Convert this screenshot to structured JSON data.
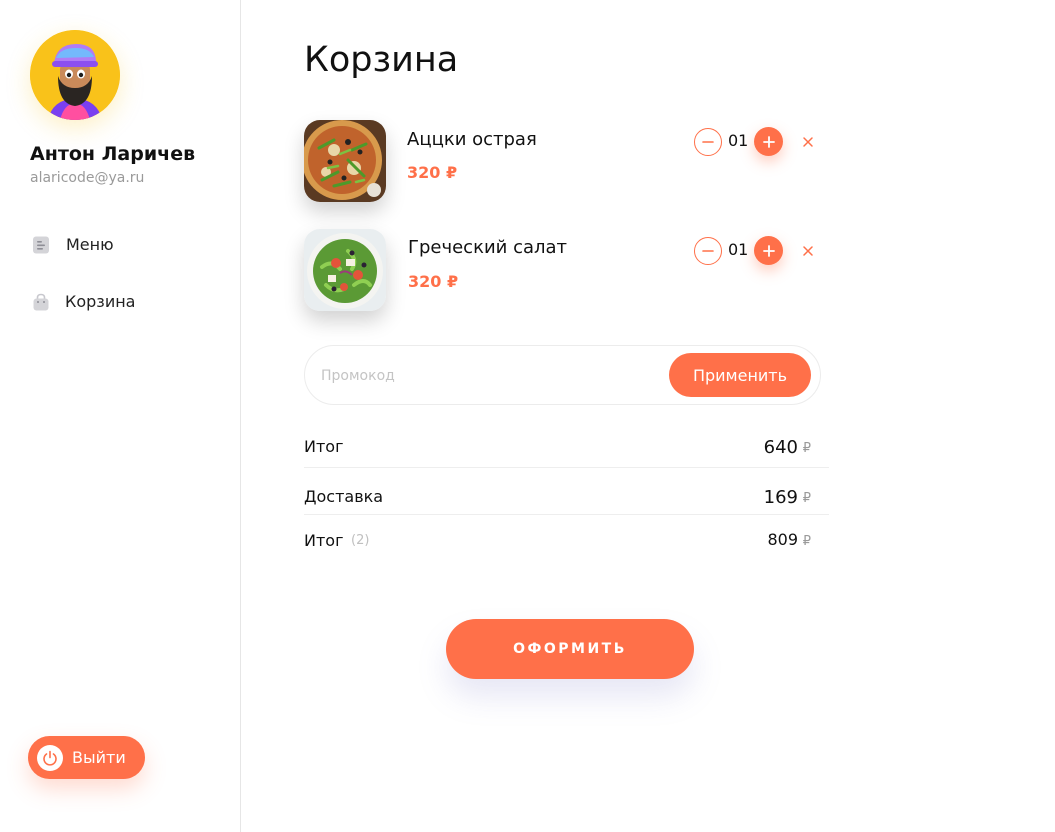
{
  "user": {
    "name": "Антон Ларичев",
    "email": "alaricode@ya.ru"
  },
  "nav": {
    "items": [
      {
        "label": "Меню",
        "icon": "menu-doc-icon"
      },
      {
        "label": "Корзина",
        "icon": "shopping-bag-icon"
      }
    ]
  },
  "logout": {
    "label": "Выйти",
    "icon": "power-icon"
  },
  "page": {
    "title": "Корзина"
  },
  "cart": {
    "items": [
      {
        "name": "Аццки острая",
        "price": "320 ₽",
        "quantity": "01",
        "image": "pizza-photo"
      },
      {
        "name": "Греческий салат",
        "price": "320 ₽",
        "quantity": "01",
        "image": "salad-photo"
      }
    ]
  },
  "promo": {
    "placeholder": "Промокод",
    "value": "",
    "apply_label": "Применить"
  },
  "summary": {
    "subtotal_label": "Итог",
    "subtotal_value": "640",
    "delivery_label": "Доставка",
    "delivery_value": "169",
    "total_label": "Итог",
    "total_count": "(2)",
    "total_value": "809",
    "currency": "₽"
  },
  "checkout": {
    "label": "ОФОРМИТЬ"
  },
  "colors": {
    "accent": "#ff7049",
    "avatar_bg": "#f9c21a"
  }
}
